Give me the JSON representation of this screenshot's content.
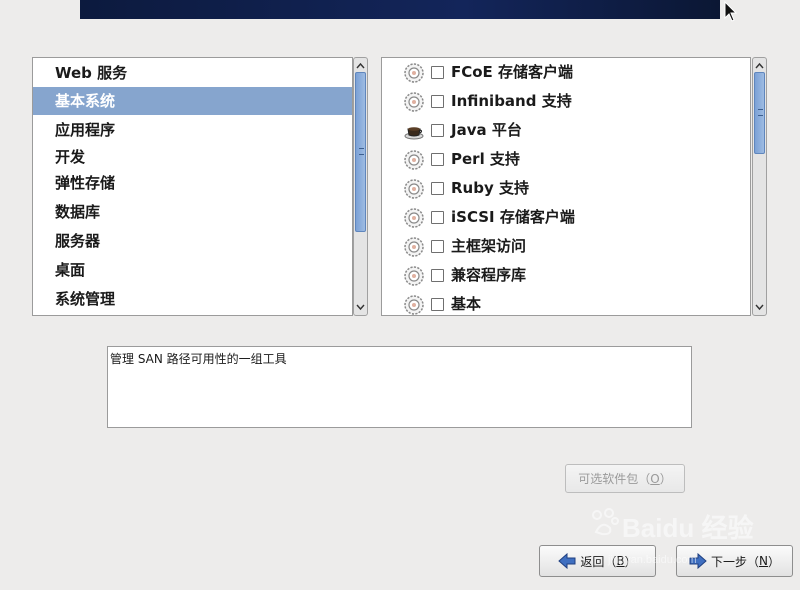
{
  "categories": {
    "selected_index": 1,
    "items": [
      {
        "label": "Web 服务"
      },
      {
        "label": "基本系统"
      },
      {
        "label": "应用程序"
      },
      {
        "label": "开发"
      },
      {
        "label": "弹性存储"
      },
      {
        "label": "数据库"
      },
      {
        "label": "服务器"
      },
      {
        "label": "桌面"
      },
      {
        "label": "系统管理"
      }
    ]
  },
  "groups": {
    "items": [
      {
        "label": "FCoE 存储客户端",
        "icon": "gear-icon",
        "checked": false
      },
      {
        "label": "Infiniband 支持",
        "icon": "gear-icon",
        "checked": false
      },
      {
        "label": "Java 平台",
        "icon": "coffee-cup-icon",
        "checked": false
      },
      {
        "label": "Perl 支持",
        "icon": "gear-icon",
        "checked": false
      },
      {
        "label": "Ruby 支持",
        "icon": "gear-icon",
        "checked": false
      },
      {
        "label": "iSCSI 存储客户端",
        "icon": "gear-icon",
        "checked": false
      },
      {
        "label": "主框架访问",
        "icon": "gear-icon",
        "checked": false
      },
      {
        "label": "兼容程序库",
        "icon": "gear-icon",
        "checked": false
      },
      {
        "label": "基本",
        "icon": "gear-icon",
        "checked": false
      }
    ]
  },
  "description": "管理 SAN 路径可用性的一组工具",
  "buttons": {
    "optional_packages": {
      "pre": "可选软件包（",
      "key": "O",
      "post": "）",
      "enabled": false
    },
    "back": {
      "pre": "返回（",
      "key": "B",
      "post": "）",
      "icon": "arrow-left-icon"
    },
    "next": {
      "pre": "下一步（",
      "key": "N",
      "post": "）",
      "icon": "arrow-right-icon"
    }
  },
  "watermark": {
    "text": "Baidu 经验",
    "url": "jingyan.baidu.com"
  },
  "colors": {
    "selection": "#86a5ce",
    "banner": "#13255a",
    "scroll_thumb": "#7ba1d6"
  }
}
